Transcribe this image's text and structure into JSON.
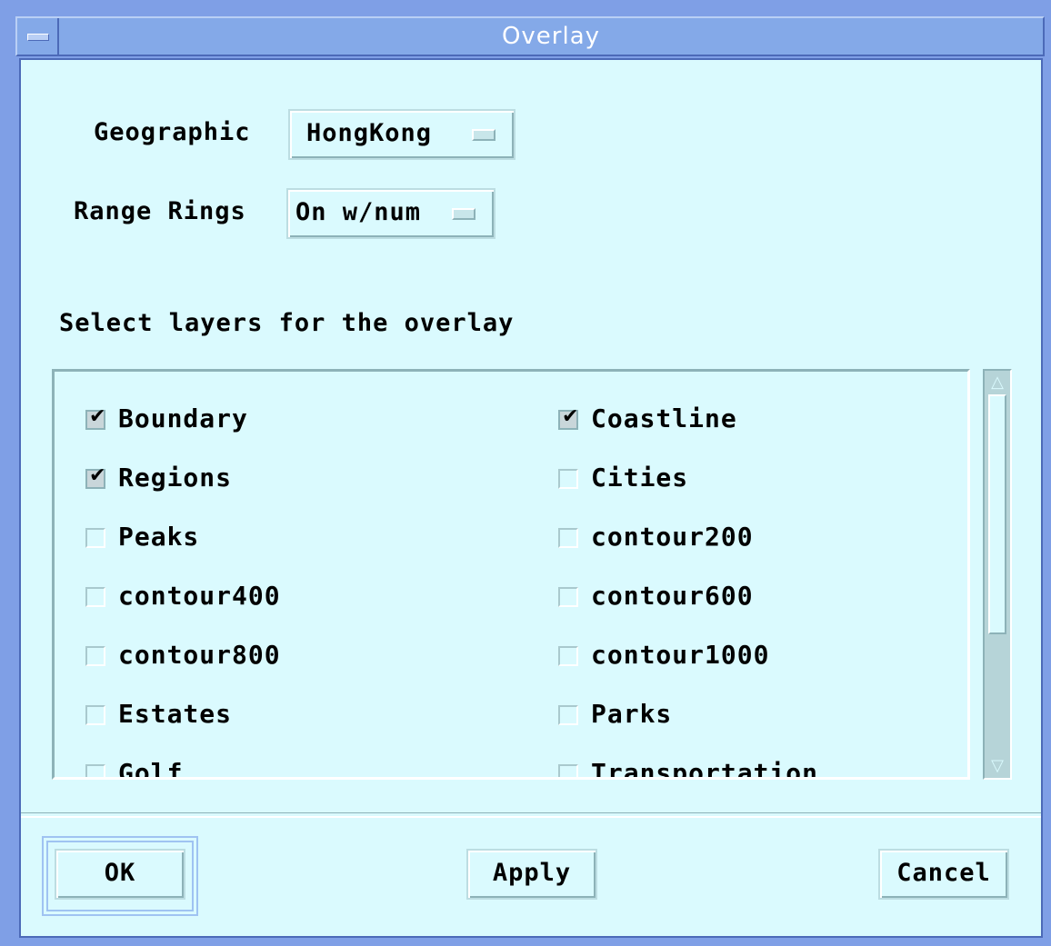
{
  "window": {
    "title": "Overlay"
  },
  "geographic": {
    "label": "Geographic",
    "value": "HongKong"
  },
  "range_rings": {
    "label": "Range Rings",
    "value": "On w/num"
  },
  "layers": {
    "heading": "Select layers for the overlay",
    "left": [
      {
        "label": "Boundary",
        "checked": true
      },
      {
        "label": "Regions",
        "checked": true
      },
      {
        "label": "Peaks",
        "checked": false
      },
      {
        "label": "contour400",
        "checked": false
      },
      {
        "label": "contour800",
        "checked": false
      },
      {
        "label": "Estates",
        "checked": false
      },
      {
        "label": "Golf",
        "checked": false
      }
    ],
    "right": [
      {
        "label": "Coastline",
        "checked": true
      },
      {
        "label": "Cities",
        "checked": false
      },
      {
        "label": "contour200",
        "checked": false
      },
      {
        "label": "contour600",
        "checked": false
      },
      {
        "label": "contour1000",
        "checked": false
      },
      {
        "label": "Parks",
        "checked": false
      },
      {
        "label": "Transportation",
        "checked": false
      }
    ]
  },
  "buttons": {
    "ok": "OK",
    "apply": "Apply",
    "cancel": "Cancel"
  },
  "icons": {
    "system_menu": "window-menu-icon",
    "option_indicator": "option-menu-indicator-icon",
    "checkmark": "checkmark-icon",
    "scroll_up": "scroll-up-arrow-icon",
    "scroll_down": "scroll-down-arrow-icon"
  },
  "colors": {
    "title_bar": "#84a9e8",
    "frame": "#7f9fe6",
    "background": "#dafafe",
    "scroll_trough": "#b6d4d8"
  }
}
